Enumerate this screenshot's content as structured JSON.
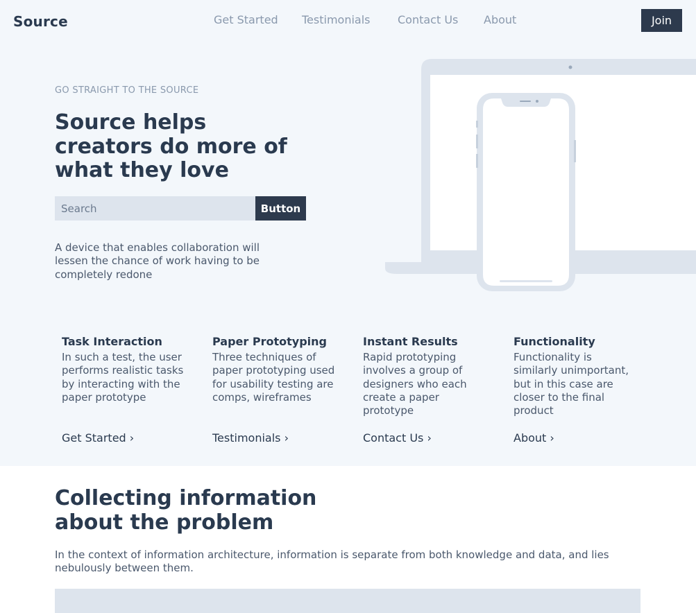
{
  "header": {
    "brand": "Source",
    "nav": [
      "Get Started",
      "Testimonials",
      "Contact Us",
      "About"
    ],
    "join_label": "Join"
  },
  "hero": {
    "eyebrow": "GO STRAIGHT TO THE SOURCE",
    "title": "Source helps creators do more of what they love",
    "search_placeholder": "Search",
    "search_button": "Button",
    "description": "A device that enables collaboration will lessen the chance of work having to be completely redone",
    "illustration_icon": "laptop-phone-illustration"
  },
  "features": [
    {
      "title": "Task Interaction",
      "description": "In such a test, the user performs realistic tasks by interacting with the paper prototype",
      "link": "Get Started ›"
    },
    {
      "title": "Paper Prototyping",
      "description": "Three techniques of paper prototyping used for usability testing are comps, wireframes",
      "link": "Testimonials ›"
    },
    {
      "title": "Instant Results",
      "description": "Rapid prototyping involves a group of designers who each create a paper prototype",
      "link": "Contact Us ›"
    },
    {
      "title": "Functionality",
      "description": "Functionality is similarly unimportant, but in this case are closer to the final product",
      "link": "About ›"
    }
  ],
  "section": {
    "title": "Collecting information about the problem",
    "description": "In the context of information architecture, information is separate from both knowledge and data, and lies nebulously between them."
  },
  "colors": {
    "dark": "#2d3a4d",
    "muted": "#8a99ad",
    "light_bg": "#f3f7fb",
    "input_bg": "#dde4ed"
  }
}
